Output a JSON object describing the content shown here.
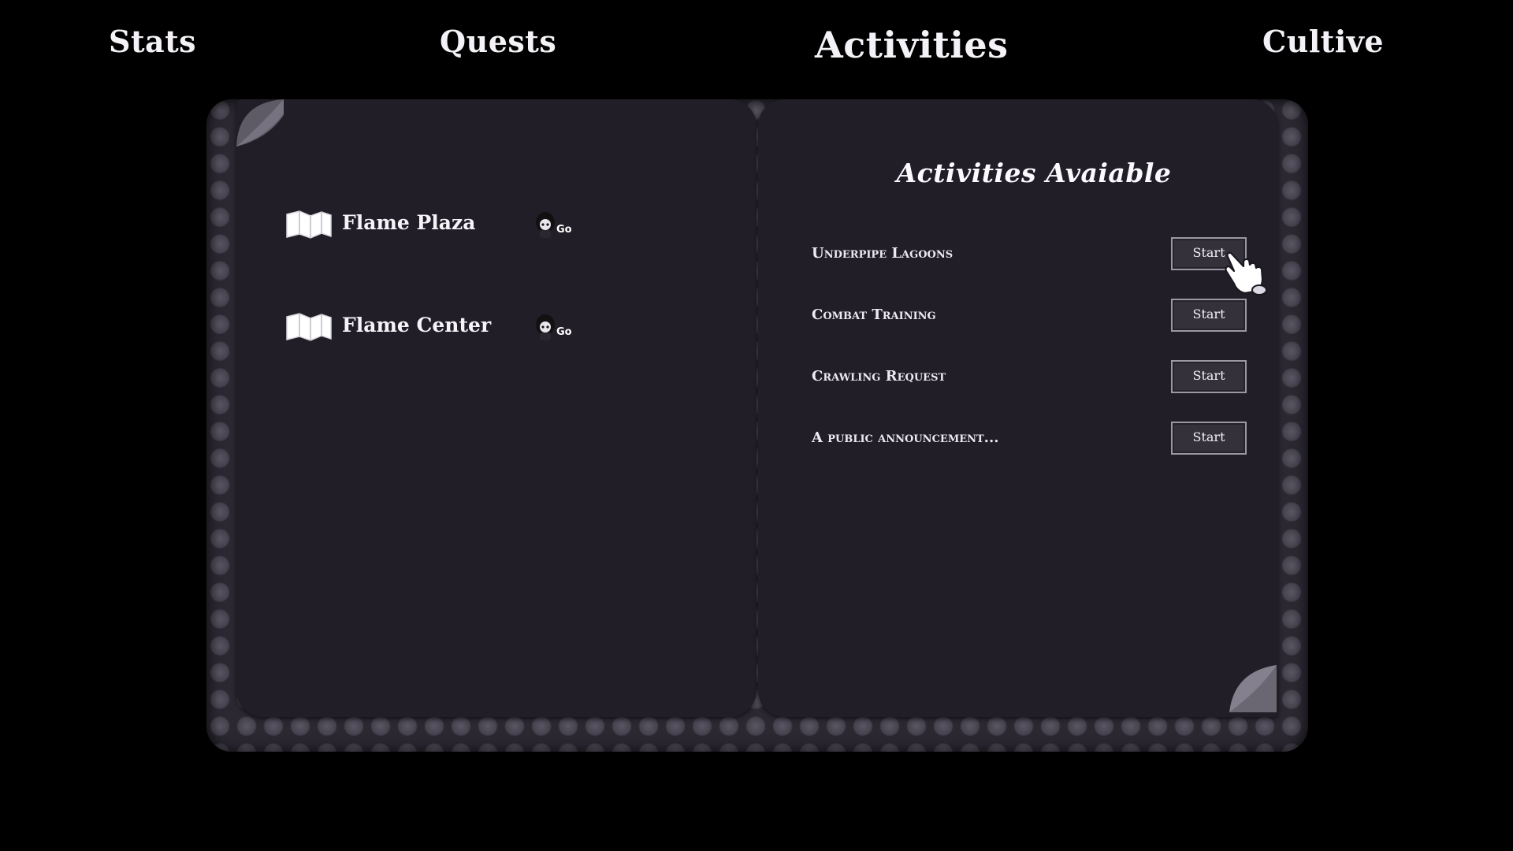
{
  "tabs": [
    {
      "label": "Stats"
    },
    {
      "label": "Quests"
    },
    {
      "label": "Activities"
    },
    {
      "label": "Cultive"
    }
  ],
  "active_tab": "Activities",
  "quests": [
    {
      "label": "Flame Plaza",
      "go_label": "Go",
      "icon": "map-icon"
    },
    {
      "label": "Flame Center",
      "go_label": "Go",
      "icon": "map-icon"
    }
  ],
  "activities_panel": {
    "title": "Activities Avaiable",
    "items": [
      {
        "label": "Underpipe Lagoons",
        "button": "Start"
      },
      {
        "label": "Combat Training",
        "button": "Start"
      },
      {
        "label": "Crawling Request",
        "button": "Start"
      },
      {
        "label": "A public announcement...",
        "button": "Start"
      }
    ]
  },
  "colors": {
    "background": "#000000",
    "page": "#211e27",
    "book_back": "#2b2832",
    "text": "#f4f2f6",
    "button_bg": "#34313a",
    "button_border": "#9b98a2"
  }
}
